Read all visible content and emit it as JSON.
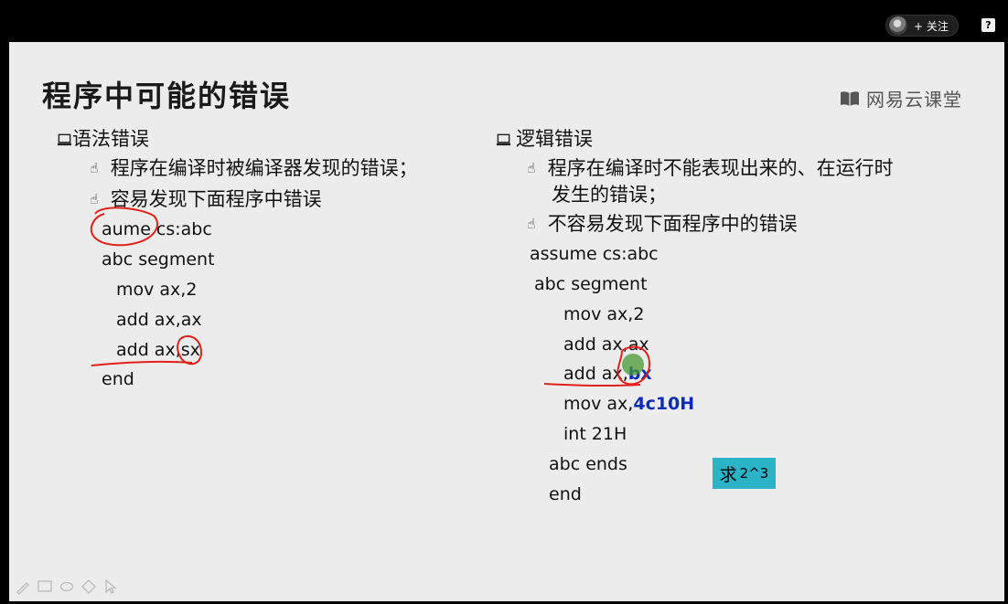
{
  "topbar": {
    "follow_label": "+ 关注",
    "help_label": "?"
  },
  "slide": {
    "title": "程序中可能的错误",
    "brand": "网易云课堂",
    "left": {
      "heading": "语法错误",
      "bullets": [
        "程序在编译时被编译器发现的错误；",
        "容易发现下面程序中错误"
      ],
      "code": [
        "aume cs:abc",
        "abc segment",
        "mov ax,2",
        "add ax,ax",
        "add ax,sx",
        "end"
      ]
    },
    "right": {
      "heading": "逻辑错误",
      "bullets": [
        "程序在编译时不能表现出来的、在运行时",
        "发生的错误；",
        "不容易发现下面程序中的错误"
      ],
      "code": {
        "l1": "assume cs:abc",
        "l2": "abc segment",
        "l3": "mov ax,2",
        "l4": "add ax,ax",
        "l5_prefix": "add ax,",
        "l5_hl": "bx",
        "l6_prefix": "mov ax,",
        "l6_hl": "4c10H",
        "l7": "int 21H",
        "l8": "abc ends",
        "l9": "end"
      }
    },
    "note": {
      "main": "求",
      "sup": "2^3"
    }
  },
  "colors": {
    "ink": "#e0201b",
    "note_bg": "#2bb3c8",
    "highlight": "#0d2bb5",
    "slide_bg": "#ececec"
  }
}
